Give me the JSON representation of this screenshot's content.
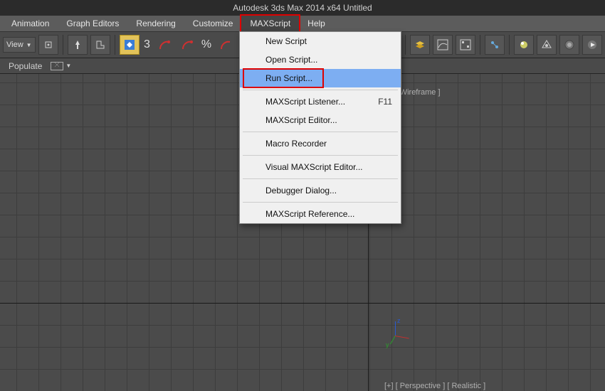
{
  "title": "Autodesk 3ds Max  2014 x64   Untitled",
  "menubar": {
    "items": [
      "Animation",
      "Graph Editors",
      "Rendering",
      "Customize",
      "MAXScript",
      "Help"
    ],
    "active_index": 4
  },
  "toolbar": {
    "view_selector": "View",
    "angle_value": "3",
    "percent_label": "%"
  },
  "secondbar": {
    "populate": "Populate"
  },
  "viewport": {
    "label_tr": "[+] [ Wireframe ]",
    "label_br": "[+] [ Perspective ] [ Realistic ]",
    "axes": {
      "z": "z",
      "y": "y"
    }
  },
  "menu": {
    "items": [
      {
        "label": "New Script",
        "shortcut": ""
      },
      {
        "label": "Open Script...",
        "shortcut": ""
      },
      {
        "label": "Run Script...",
        "shortcut": "",
        "highlighted": true,
        "redbox": true
      },
      {
        "sep": true
      },
      {
        "label": "MAXScript Listener...",
        "shortcut": "F11"
      },
      {
        "label": "MAXScript Editor...",
        "shortcut": ""
      },
      {
        "sep": true
      },
      {
        "label": "Macro Recorder",
        "shortcut": ""
      },
      {
        "sep": true
      },
      {
        "label": "Visual MAXScript Editor...",
        "shortcut": ""
      },
      {
        "sep": true
      },
      {
        "label": "Debugger Dialog...",
        "shortcut": ""
      },
      {
        "sep": true
      },
      {
        "label": "MAXScript Reference...",
        "shortcut": ""
      }
    ]
  },
  "colors": {
    "highlight_red": "#d00",
    "menu_hover": "#7daef2"
  }
}
